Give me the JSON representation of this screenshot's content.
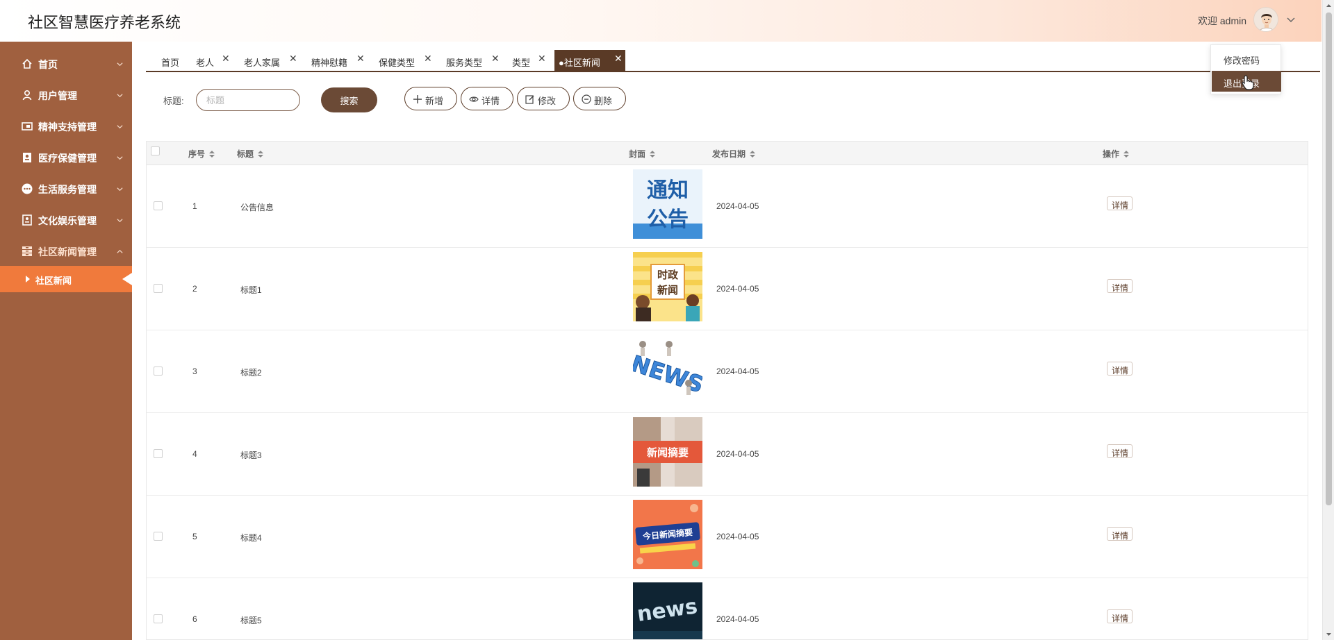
{
  "app": {
    "title": "社区智慧医疗养老系统"
  },
  "header": {
    "welcome": "欢迎 admin",
    "user_menu": [
      "修改密码",
      "退出登录"
    ]
  },
  "sidebar": {
    "items": [
      {
        "label": "首页",
        "icon": "home-icon",
        "expanded": false
      },
      {
        "label": "用户管理",
        "icon": "user-icon",
        "expanded": false
      },
      {
        "label": "精神支持管理",
        "icon": "spirit-icon",
        "expanded": false
      },
      {
        "label": "医疗保健管理",
        "icon": "medical-icon",
        "expanded": false
      },
      {
        "label": "生活服务管理",
        "icon": "service-icon",
        "expanded": false
      },
      {
        "label": "文化娱乐管理",
        "icon": "culture-icon",
        "expanded": false
      },
      {
        "label": "社区新闻管理",
        "icon": "news-icon",
        "expanded": true
      }
    ],
    "active_sub": "社区新闻"
  },
  "tabs": [
    {
      "label": "首页",
      "closable": false
    },
    {
      "label": "老人",
      "closable": true
    },
    {
      "label": "老人家属",
      "closable": true
    },
    {
      "label": "精神慰籍",
      "closable": true
    },
    {
      "label": "保健类型",
      "closable": true
    },
    {
      "label": "服务类型",
      "closable": true
    },
    {
      "label": "类型",
      "closable": true
    },
    {
      "label": "●社区新闻",
      "closable": true,
      "active": true
    }
  ],
  "search": {
    "label": "标题:",
    "placeholder": "标题",
    "button": "搜索"
  },
  "toolbar": {
    "add": "新增",
    "detail": "详情",
    "edit": "修改",
    "delete": "删除"
  },
  "table": {
    "columns": [
      "序号",
      "标题",
      "封面",
      "发布日期",
      "操作"
    ],
    "rows": [
      {
        "index": "1",
        "title": "公告信息",
        "date": "2024-04-05",
        "cover": "notice-image",
        "cover_text": [
          "通知",
          "公告"
        ],
        "action": "详情"
      },
      {
        "index": "2",
        "title": "标题1",
        "date": "2024-04-05",
        "cover": "politics-news-image",
        "cover_text": [
          "时政",
          "新闻"
        ],
        "action": "详情"
      },
      {
        "index": "3",
        "title": "标题2",
        "date": "2024-04-05",
        "cover": "news-3d-image",
        "cover_text": [
          "NEWS"
        ],
        "action": "详情"
      },
      {
        "index": "4",
        "title": "标题3",
        "date": "2024-04-05",
        "cover": "news-summary-image",
        "cover_text": [
          "新闻摘要"
        ],
        "action": "详情"
      },
      {
        "index": "5",
        "title": "标题4",
        "date": "2024-04-05",
        "cover": "today-news-image",
        "cover_text": [
          "今日新闻摘要"
        ],
        "action": "详情"
      },
      {
        "index": "6",
        "title": "标题5",
        "date": "2024-04-05",
        "cover": "news-dark-image",
        "cover_text": [
          "news"
        ],
        "action": "详情"
      }
    ]
  },
  "colors": {
    "sidebar": "#a0603f",
    "accent": "#f07a3c",
    "brand_dark": "#5a3a26",
    "button": "#6b4a36"
  }
}
